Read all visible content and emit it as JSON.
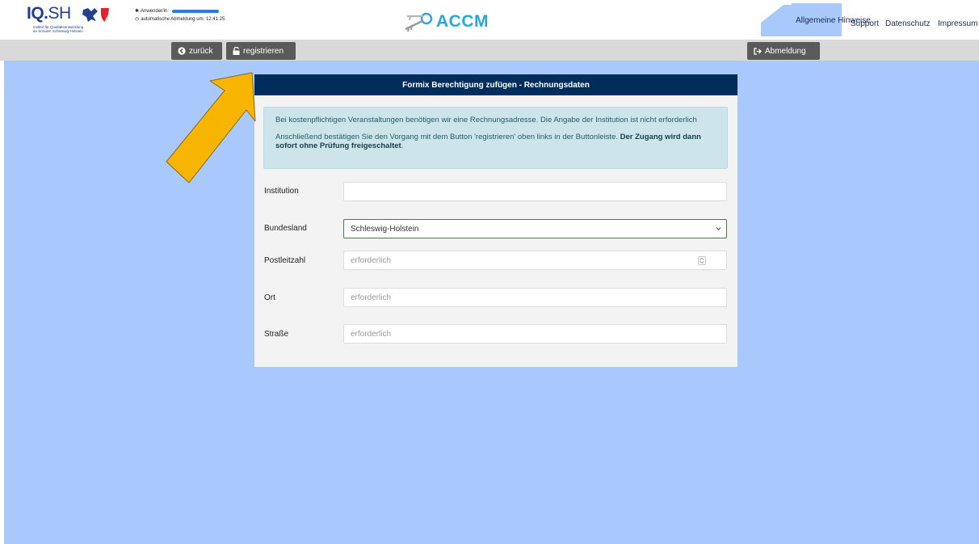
{
  "header": {
    "logo": {
      "text_bold": "IQ.",
      "text_light": "SH",
      "subtitle_line1": "Institut für Qualitätsentwicklung",
      "subtitle_line2": "an Schulen Schleswig-Holstein"
    },
    "user": {
      "label": "Anwender/in:",
      "logout_info": "automatische Abmeldung um: 12:41:25"
    },
    "brand": {
      "name": "ACCM"
    },
    "nav": {
      "general": "Allgemeine Hinweise",
      "support": "Support",
      "privacy": "Datenschutz",
      "imprint": "Impressum"
    }
  },
  "toolbar": {
    "back_label": "zurück",
    "register_label": "registrieren",
    "logout_label": "Abmeldung"
  },
  "panel": {
    "title": "Formix Berechtigung zufügen - Rechnungsdaten",
    "info_paragraph1": "Bei kostenpflichtigen Veranstaltungen benötigen wir eine Rechnungsadresse. Die Angabe der Institution ist nicht erforderlich",
    "info_paragraph2_text": "Anschließend bestätigen Sie den Vorgang mit dem Button 'registrieren' oben links in der Buttonleiste.",
    "info_paragraph2_bold": "Der Zugang wird dann sofort ohne Prüfung freigeschaltet",
    "info_paragraph2_end": "."
  },
  "form": {
    "institution": {
      "label": "Institution",
      "value": "",
      "placeholder": ""
    },
    "state": {
      "label": "Bundesland",
      "value": "Schleswig-Holstein"
    },
    "zip": {
      "label": "Postleitzahl",
      "value": "",
      "placeholder": "erforderlich"
    },
    "city": {
      "label": "Ort",
      "value": "",
      "placeholder": "erforderlich"
    },
    "street": {
      "label": "Straße",
      "value": "",
      "placeholder": "erforderlich"
    }
  },
  "colors": {
    "header_dark": "#002d5c",
    "background_blue": "#a9c9fd",
    "button_gray": "#5a5a5a",
    "toolbar_gray": "#d9d9d9",
    "info_bg": "#cde5ea",
    "brand_blue": "#29a8e0",
    "arrow_yellow": "#f7b500"
  }
}
